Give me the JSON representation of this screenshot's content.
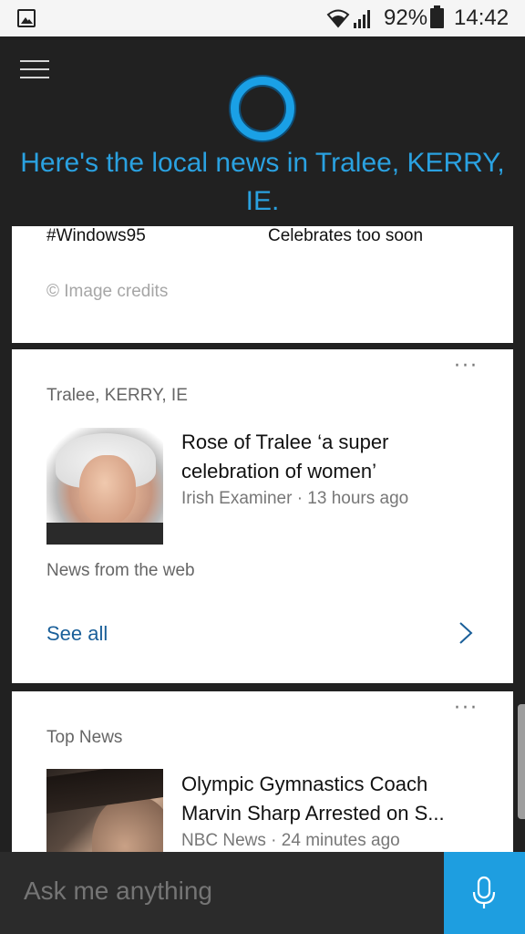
{
  "status_bar": {
    "battery": "92%",
    "time": "14:42",
    "icons": [
      "gallery-icon",
      "wifi-icon",
      "signal-icon",
      "battery-icon"
    ]
  },
  "header": {
    "menu_icon": "hamburger-menu-icon",
    "logo_icon": "cortana-ring-icon",
    "headline": "Here's the local news in Tralee, KERRY, IE."
  },
  "card1": {
    "left_text": "#Windows95",
    "right_text": "Celebrates too soon",
    "credit": "© Image credits"
  },
  "card2": {
    "more": "···",
    "location": "Tralee, KERRY, IE",
    "article": {
      "title": "Rose of Tralee ‘a super celebration of women’",
      "meta": "Irish Examiner · 13 hours ago"
    },
    "footer": "News from the web",
    "see_all": "See all"
  },
  "card3": {
    "more": "···",
    "label": "Top News",
    "article": {
      "title": "Olympic Gymnastics Coach Marvin Sharp Arrested on S...",
      "meta": "NBC News · 24 minutes ago"
    }
  },
  "bottom": {
    "placeholder": "Ask me anything",
    "mic_icon": "microphone-icon"
  },
  "colors": {
    "accent": "#1e9ee0",
    "headline": "#2aa1e0",
    "link": "#1a5f99",
    "background": "#212121"
  }
}
